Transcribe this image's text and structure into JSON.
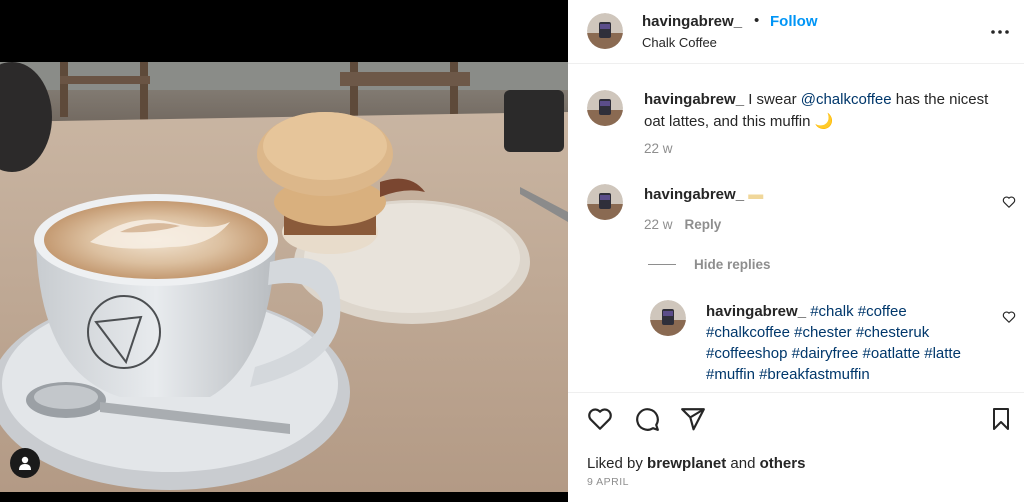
{
  "post": {
    "username": "havingabrew_",
    "separator": "•",
    "follow_label": "Follow",
    "location": "Chalk Coffee"
  },
  "icons": {
    "more": "more-options-icon",
    "heart": "heart-icon",
    "comment": "comment-icon",
    "share": "paper-plane-icon",
    "save": "bookmark-icon",
    "tagged": "user-tag-icon"
  },
  "comments": [
    {
      "username": "havingabrew_",
      "text_prefix": " I swear ",
      "mention": "@chalkcoffee",
      "text_suffix": " has the nicest oat lattes, and this muffin 🌙",
      "time": "22 w"
    },
    {
      "username": "havingabrew_",
      "emoji": " ▬",
      "time": "22 w",
      "reply_label": "Reply"
    }
  ],
  "hide_replies_label": "Hide replies",
  "reply": {
    "username": "havingabrew_",
    "hashtags": [
      "#chalk",
      "#coffee",
      "#chalkcoffee",
      "#chester",
      "#chesteruk",
      "#coffeeshop",
      "#dairyfree",
      "#oatlatte",
      "#latte",
      "#muffin",
      "#breakfastmuffin"
    ]
  },
  "likes": {
    "prefix": "Liked by ",
    "user": "brewplanet",
    "middle": " and ",
    "others": "others"
  },
  "date": "9 APRIL",
  "colors": {
    "link_blue": "#0095f6",
    "hashtag": "#00376b",
    "muted": "#8e8e8e"
  }
}
